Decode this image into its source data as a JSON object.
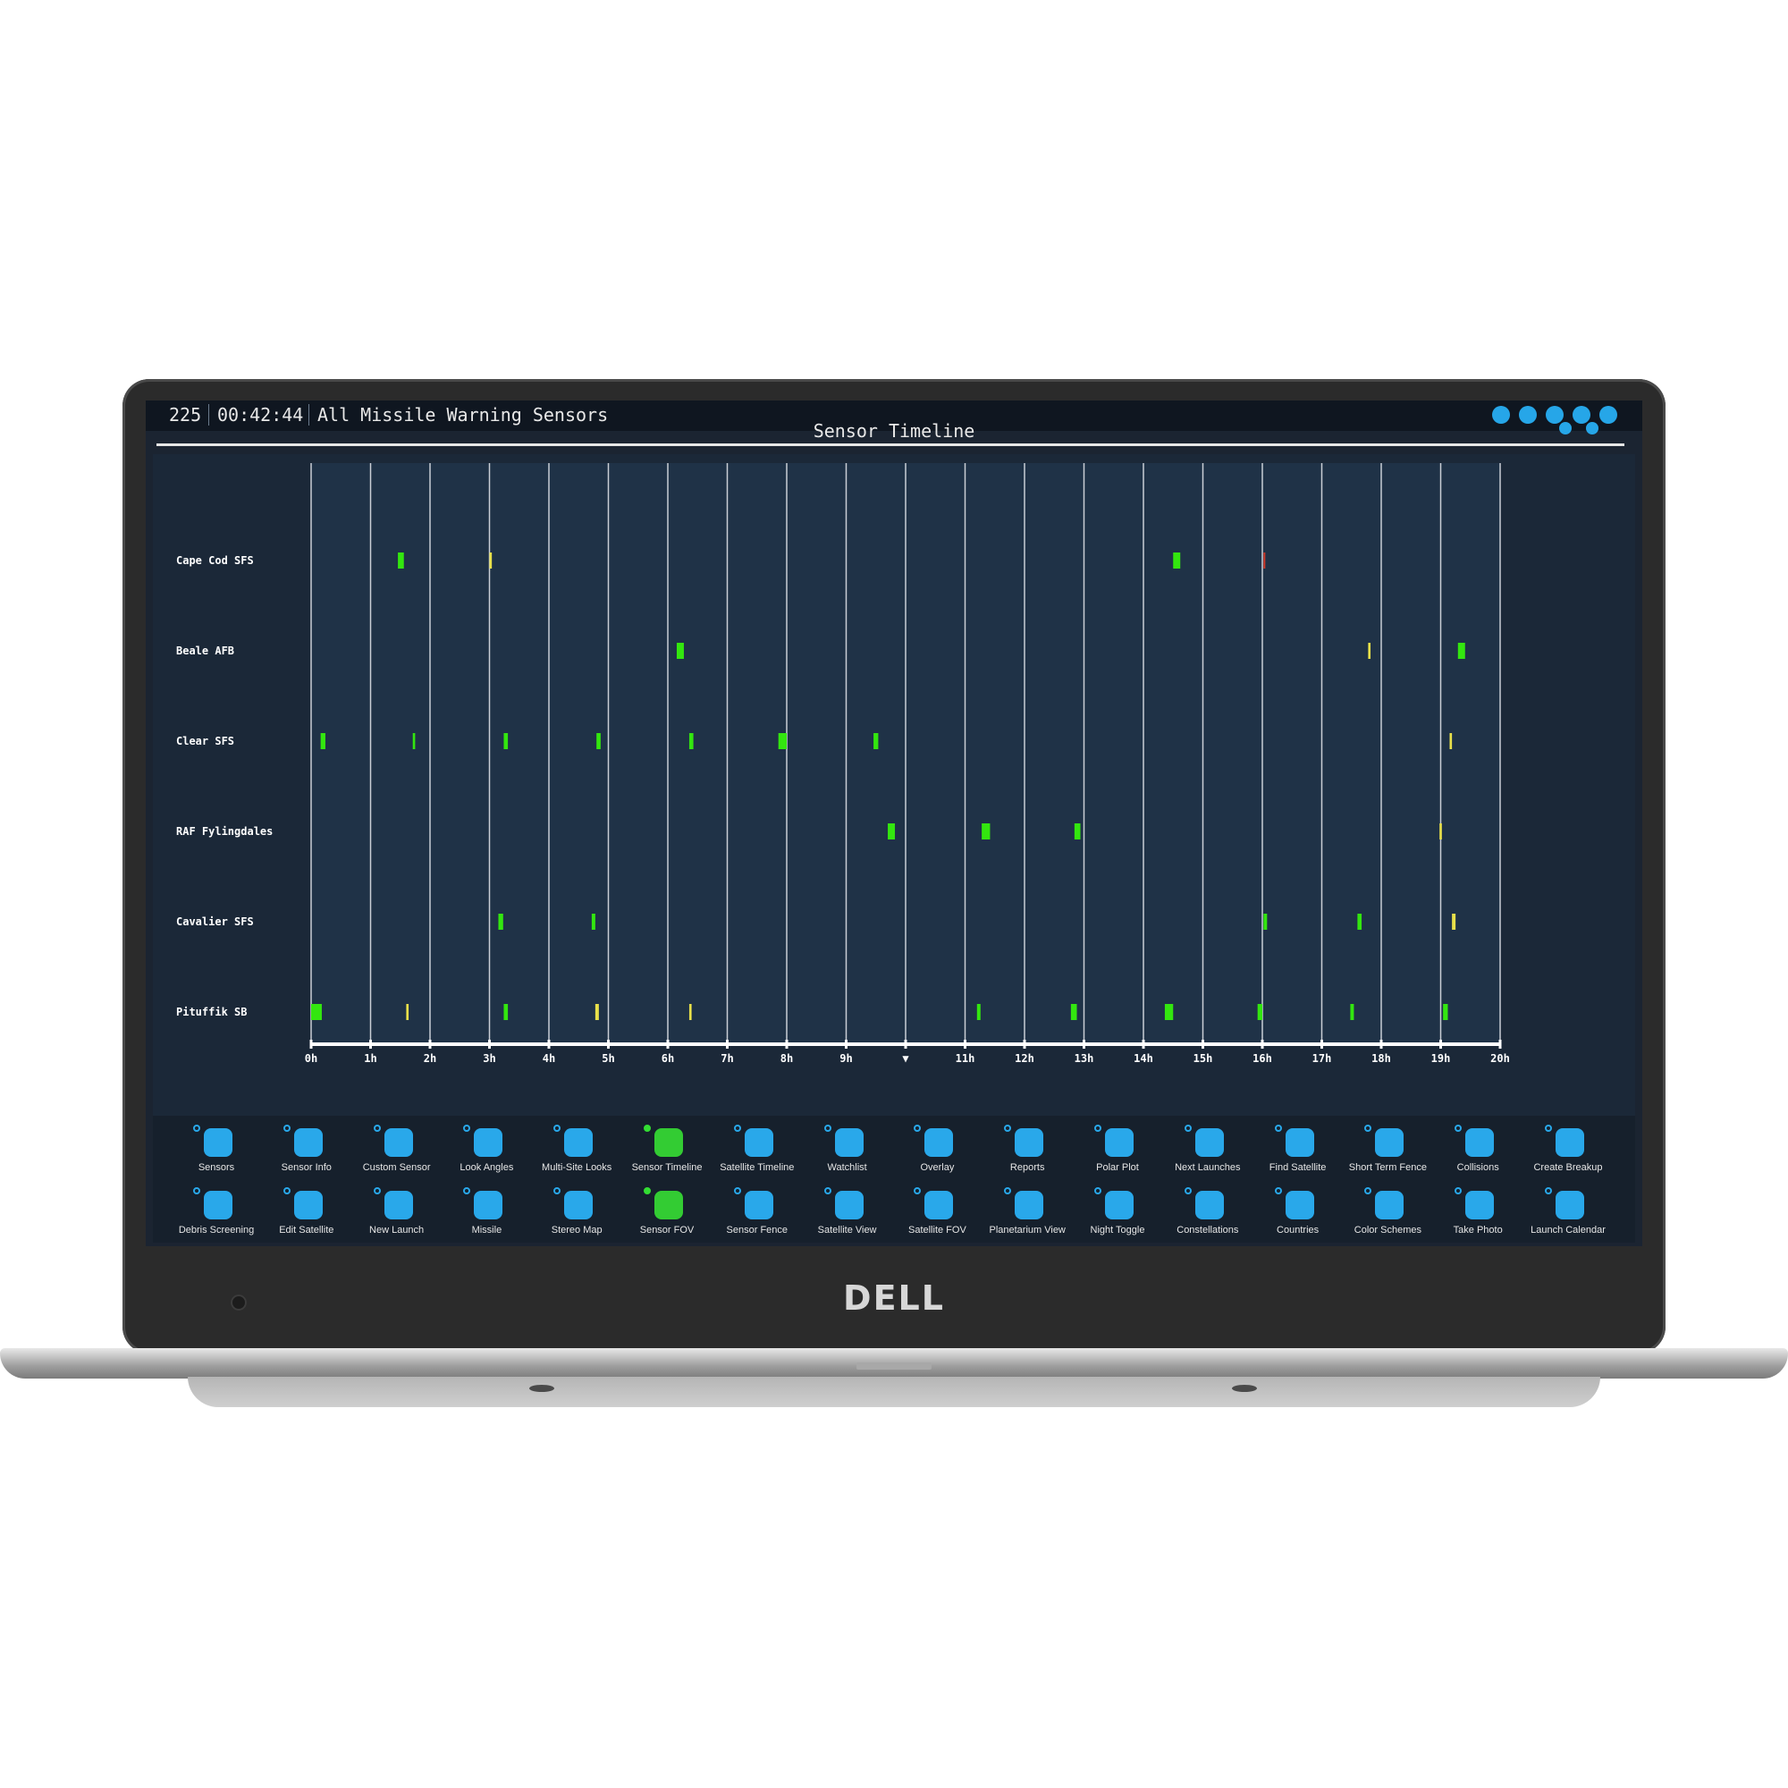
{
  "header": {
    "count": "225",
    "time": "00:42:44",
    "sensor_group": "All Missile Warning Sensors",
    "title": "Sensor Timeline",
    "icons": [
      "github-icon",
      "volume-icon",
      "layers-icon",
      "help-icon",
      "search-icon",
      "download-icon",
      "settings-icon"
    ]
  },
  "chart_data": {
    "type": "timeline",
    "sensors": [
      "Cape Cod SFS",
      "Beale AFB",
      "Clear SFS",
      "RAF Fylingdales",
      "Cavalier SFS",
      "Pituffik SB"
    ],
    "x_tick_labels": [
      "0h",
      "1h",
      "2h",
      "3h",
      "4h",
      "5h",
      "6h",
      "7h",
      "8h",
      "9h",
      "▼",
      "11h",
      "12h",
      "13h",
      "14h",
      "15h",
      "16h",
      "17h",
      "18h",
      "19h",
      "20h"
    ],
    "xlim": [
      0,
      20
    ],
    "colors": {
      "good": "#33e60f",
      "ok": "#e8e04a",
      "bad": "#d23a2a",
      "background": "#1b2838",
      "lane": "#1f3247",
      "grid": "#c9ced6"
    },
    "passes": [
      {
        "sensor": "Cape Cod SFS",
        "start": 1.46,
        "end": 1.56,
        "quality": "good"
      },
      {
        "sensor": "Cape Cod SFS",
        "start": 3.0,
        "end": 3.04,
        "quality": "ok"
      },
      {
        "sensor": "Cape Cod SFS",
        "start": 14.5,
        "end": 14.62,
        "quality": "good"
      },
      {
        "sensor": "Cape Cod SFS",
        "start": 16.02,
        "end": 16.04,
        "quality": "bad"
      },
      {
        "sensor": "Beale AFB",
        "start": 6.15,
        "end": 6.27,
        "quality": "good"
      },
      {
        "sensor": "Beale AFB",
        "start": 17.78,
        "end": 17.82,
        "quality": "ok"
      },
      {
        "sensor": "Beale AFB",
        "start": 19.29,
        "end": 19.41,
        "quality": "good"
      },
      {
        "sensor": "Clear SFS",
        "start": 0.16,
        "end": 0.24,
        "quality": "good"
      },
      {
        "sensor": "Clear SFS",
        "start": 1.71,
        "end": 1.75,
        "quality": "good"
      },
      {
        "sensor": "Clear SFS",
        "start": 3.24,
        "end": 3.31,
        "quality": "good"
      },
      {
        "sensor": "Clear SFS",
        "start": 4.8,
        "end": 4.87,
        "quality": "good"
      },
      {
        "sensor": "Clear SFS",
        "start": 6.36,
        "end": 6.43,
        "quality": "good"
      },
      {
        "sensor": "Clear SFS",
        "start": 7.86,
        "end": 8.0,
        "quality": "good"
      },
      {
        "sensor": "Clear SFS",
        "start": 9.46,
        "end": 9.54,
        "quality": "good"
      },
      {
        "sensor": "Clear SFS",
        "start": 19.15,
        "end": 19.19,
        "quality": "ok"
      },
      {
        "sensor": "RAF Fylingdales",
        "start": 9.7,
        "end": 9.82,
        "quality": "good"
      },
      {
        "sensor": "RAF Fylingdales",
        "start": 11.28,
        "end": 11.42,
        "quality": "good"
      },
      {
        "sensor": "RAF Fylingdales",
        "start": 12.84,
        "end": 12.94,
        "quality": "good"
      },
      {
        "sensor": "RAF Fylingdales",
        "start": 18.98,
        "end": 19.02,
        "quality": "ok"
      },
      {
        "sensor": "Cavalier SFS",
        "start": 3.15,
        "end": 3.23,
        "quality": "good"
      },
      {
        "sensor": "Cavalier SFS",
        "start": 4.72,
        "end": 4.78,
        "quality": "good"
      },
      {
        "sensor": "Cavalier SFS",
        "start": 16.02,
        "end": 16.08,
        "quality": "good"
      },
      {
        "sensor": "Cavalier SFS",
        "start": 17.6,
        "end": 17.67,
        "quality": "good"
      },
      {
        "sensor": "Cavalier SFS",
        "start": 19.19,
        "end": 19.25,
        "quality": "ok"
      },
      {
        "sensor": "Pituffik SB",
        "start": 0.0,
        "end": 0.18,
        "quality": "good"
      },
      {
        "sensor": "Pituffik SB",
        "start": 1.6,
        "end": 1.64,
        "quality": "ok"
      },
      {
        "sensor": "Pituffik SB",
        "start": 3.24,
        "end": 3.31,
        "quality": "good"
      },
      {
        "sensor": "Pituffik SB",
        "start": 4.78,
        "end": 4.84,
        "quality": "ok"
      },
      {
        "sensor": "Pituffik SB",
        "start": 6.36,
        "end": 6.4,
        "quality": "ok"
      },
      {
        "sensor": "Pituffik SB",
        "start": 11.2,
        "end": 11.26,
        "quality": "good"
      },
      {
        "sensor": "Pituffik SB",
        "start": 12.78,
        "end": 12.88,
        "quality": "good"
      },
      {
        "sensor": "Pituffik SB",
        "start": 14.36,
        "end": 14.5,
        "quality": "good"
      },
      {
        "sensor": "Pituffik SB",
        "start": 15.92,
        "end": 16.0,
        "quality": "good"
      },
      {
        "sensor": "Pituffik SB",
        "start": 17.48,
        "end": 17.54,
        "quality": "good"
      },
      {
        "sensor": "Pituffik SB",
        "start": 19.04,
        "end": 19.12,
        "quality": "good"
      }
    ]
  },
  "menu": {
    "row1": [
      {
        "label": "Sensors",
        "icon": "radar-icon",
        "active": false
      },
      {
        "label": "Sensor Info",
        "icon": "info-icon",
        "active": false
      },
      {
        "label": "Custom Sensor",
        "icon": "wrench-icon",
        "active": false
      },
      {
        "label": "Look Angles",
        "icon": "table-icon",
        "active": false
      },
      {
        "label": "Multi-Site Looks",
        "icon": "list-icon",
        "active": false
      },
      {
        "label": "Sensor Timeline",
        "icon": "timeline-icon",
        "active": true
      },
      {
        "label": "Satellite Timeline",
        "icon": "satellite-timeline-icon",
        "active": false
      },
      {
        "label": "Watchlist",
        "icon": "bookmarks-icon",
        "active": false
      },
      {
        "label": "Overlay",
        "icon": "eye-icon",
        "active": false
      },
      {
        "label": "Reports",
        "icon": "document-icon",
        "active": false
      },
      {
        "label": "Polar Plot",
        "icon": "polar-icon",
        "active": false
      },
      {
        "label": "Next Launches",
        "icon": "calendar-icon",
        "active": false
      },
      {
        "label": "Find Satellite",
        "icon": "find-icon",
        "active": false
      },
      {
        "label": "Short Term Fence",
        "icon": "fence-icon",
        "active": false
      },
      {
        "label": "Collisions",
        "icon": "collision-icon",
        "active": false
      },
      {
        "label": "Create Breakup",
        "icon": "breakup-icon",
        "active": false
      }
    ],
    "row2": [
      {
        "label": "Debris Screening",
        "icon": "debris-search-icon",
        "active": false
      },
      {
        "label": "Edit Satellite",
        "icon": "pencil-icon",
        "active": false
      },
      {
        "label": "New Launch",
        "icon": "rocket-icon",
        "active": false
      },
      {
        "label": "Missile",
        "icon": "missile-icon",
        "active": false
      },
      {
        "label": "Stereo Map",
        "icon": "map-icon",
        "active": false
      },
      {
        "label": "Sensor FOV",
        "icon": "globe-icon",
        "active": true
      },
      {
        "label": "Sensor Fence",
        "icon": "sensor-fence-icon",
        "active": false
      },
      {
        "label": "Satellite View",
        "icon": "cube-icon",
        "active": false
      },
      {
        "label": "Satellite FOV",
        "icon": "satellite-fov-icon",
        "active": false
      },
      {
        "label": "Planetarium View",
        "icon": "home-icon",
        "active": false
      },
      {
        "label": "Night Toggle",
        "icon": "contrast-icon",
        "active": false
      },
      {
        "label": "Constellations",
        "icon": "shapes-icon",
        "active": false
      },
      {
        "label": "Countries",
        "icon": "flag-icon",
        "active": false
      },
      {
        "label": "Color Schemes",
        "icon": "palette-icon",
        "active": false
      },
      {
        "label": "Take Photo",
        "icon": "camera-icon",
        "active": false
      },
      {
        "label": "Launch Calendar",
        "icon": "launch-calendar-icon",
        "active": false
      }
    ]
  },
  "brand": "DELL"
}
